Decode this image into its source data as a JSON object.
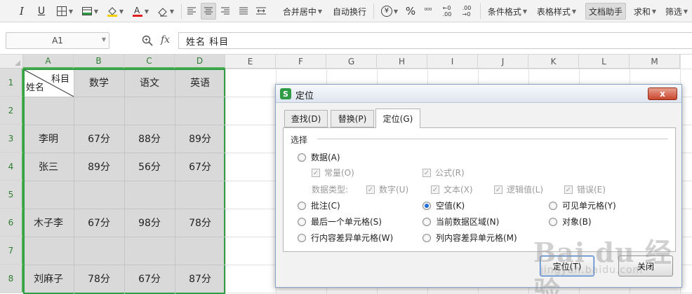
{
  "toolbar": {
    "italic": "I",
    "underline": "U",
    "merge_center": "合并居中",
    "wrap_text": "自动换行",
    "currency": "¥",
    "percent": "%",
    "thousands": "⁰⁰⁰",
    "inc_decimal": "←0\n.00",
    "dec_decimal": ".00\n→0",
    "conditional_format": "条件格式",
    "table_style": "表格样式",
    "doc_assistant": "文档助手",
    "sum": "求和",
    "filter": "筛选"
  },
  "formula_bar": {
    "cell_ref": "A1",
    "fx": "fx",
    "content": "姓名  科目"
  },
  "columns": [
    "A",
    "B",
    "C",
    "D",
    "E",
    "F",
    "G",
    "H",
    "I",
    "J",
    "K",
    "L",
    "M"
  ],
  "rows": [
    "1",
    "2",
    "3",
    "4",
    "5",
    "6",
    "7",
    "8"
  ],
  "cells": {
    "a1_top": "科目",
    "a1_bottom": "姓名",
    "b1": "数学",
    "c1": "语文",
    "d1": "英语",
    "a3": "李明",
    "b3": "67分",
    "c3": "88分",
    "d3": "89分",
    "a4": "张三",
    "b4": "89分",
    "c4": "56分",
    "d4": "67分",
    "a6": "木子李",
    "b6": "67分",
    "c6": "98分",
    "d6": "78分",
    "a8": "刘麻子",
    "b8": "78分",
    "c8": "67分",
    "d8": "87分"
  },
  "dialog": {
    "logo": "S",
    "title": "定位",
    "close": "x",
    "tabs": [
      "查找(D)",
      "替换(P)",
      "定位(G)"
    ],
    "section": "选择",
    "options": {
      "data": "数据(A)",
      "constant": "常量(O)",
      "formula": "公式(R)",
      "data_type": "数据类型:",
      "number": "数字(U)",
      "text": "文本(X)",
      "logical": "逻辑值(L)",
      "error": "错误(E)",
      "comment": "批注(C)",
      "blank": "空值(K)",
      "visible_cells": "可见单元格(Y)",
      "last_cell": "最后一个单元格(S)",
      "current_region": "当前数据区域(N)",
      "objects": "对象(B)",
      "row_diff": "行内容差异单元格(W)",
      "col_diff": "列内容差异单元格(M)"
    },
    "locate_button": "定位(T)",
    "close_button": "关闭"
  },
  "watermark": {
    "brand": "Bai du 经验",
    "url": "jingyan.baidu.com"
  },
  "colors": {
    "selection_border": "#2f9e44",
    "selection_fill": "#d9d9d9",
    "radio_checked": "#1f6fd8"
  }
}
